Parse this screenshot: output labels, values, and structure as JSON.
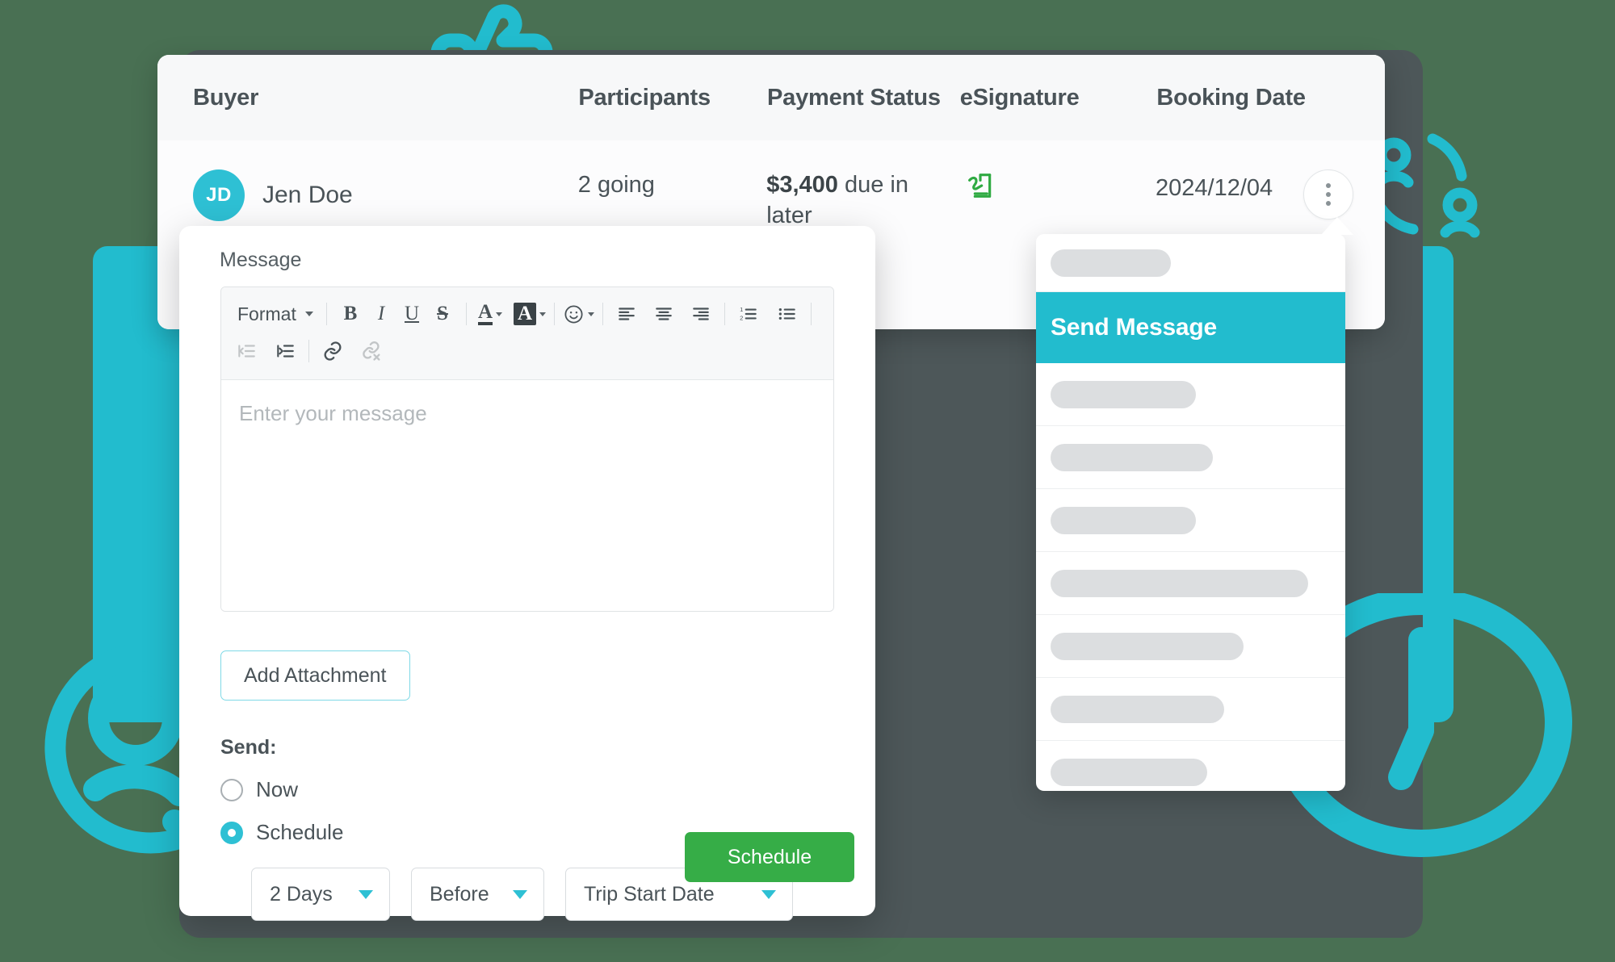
{
  "theme": {
    "page_background": "#497053",
    "card_dark": "#4D5759",
    "accent_cyan": "#22BCCE",
    "accent_cyan_light": "#2EC0D4",
    "success_green": "#36AD47",
    "esignature_green": "#2FAA42",
    "text_primary": "#4A5358",
    "placeholder_gray": "#B3B8BB",
    "skeleton_gray": "#DCDEE0"
  },
  "decorations": [
    {
      "name": "thumbs-up-icon",
      "color": "#22BCCE"
    },
    {
      "name": "smiley-face-icon",
      "color": "#22BCCE"
    },
    {
      "name": "clock-icon",
      "color": "#22BCCE"
    },
    {
      "name": "users-group-icon",
      "color": "#22BCCE"
    }
  ],
  "bookings_table": {
    "columns": [
      {
        "key": "buyer",
        "label": "Buyer"
      },
      {
        "key": "participants",
        "label": "Participants"
      },
      {
        "key": "payment_status",
        "label": "Payment Status"
      },
      {
        "key": "esignature",
        "label": "eSignature"
      },
      {
        "key": "booking_date",
        "label": "Booking Date"
      }
    ],
    "rows": [
      {
        "avatar_initials": "JD",
        "buyer_name": "Jen Doe",
        "participants": "2 going",
        "payment_amount": "$3,400",
        "payment_rest": " due in later",
        "esignature_icon": "signature-icon",
        "booking_date": "2024/12/04",
        "row_menu_icon": "kebab-menu-icon"
      }
    ]
  },
  "composer": {
    "label": "Message",
    "toolbar": {
      "format_label": "Format",
      "buttons": [
        {
          "name": "bold-icon",
          "glyph": "B"
        },
        {
          "name": "italic-icon",
          "glyph": "I"
        },
        {
          "name": "underline-icon",
          "glyph": "U"
        },
        {
          "name": "strikethrough-icon",
          "glyph": "S"
        },
        {
          "name": "text-color-icon",
          "glyph": "A"
        },
        {
          "name": "highlight-color-icon",
          "glyph": "A"
        },
        {
          "name": "emoji-icon",
          "glyph": "☺"
        },
        {
          "name": "align-left-icon",
          "glyph": ""
        },
        {
          "name": "align-center-icon",
          "glyph": ""
        },
        {
          "name": "align-right-icon",
          "glyph": ""
        },
        {
          "name": "ordered-list-icon",
          "glyph": ""
        },
        {
          "name": "unordered-list-icon",
          "glyph": ""
        },
        {
          "name": "outdent-icon",
          "glyph": ""
        },
        {
          "name": "indent-icon",
          "glyph": ""
        },
        {
          "name": "insert-link-icon",
          "glyph": ""
        },
        {
          "name": "remove-link-icon",
          "glyph": ""
        }
      ]
    },
    "message_placeholder": "Enter your message",
    "message_value": "",
    "add_attachment_label": "Add Attachment",
    "send_section_label": "Send:",
    "send_options": [
      {
        "label": "Now",
        "selected": false
      },
      {
        "label": "Schedule",
        "selected": true
      }
    ],
    "schedule_selects": [
      {
        "name": "schedule-offset-select",
        "value": "2 Days"
      },
      {
        "name": "schedule-relation-select",
        "value": "Before"
      },
      {
        "name": "schedule-anchor-select",
        "value": "Trip Start Date"
      }
    ],
    "submit_label": "Schedule"
  },
  "context_menu": {
    "active_item_label": "Send Message",
    "items": [
      {
        "type": "skeleton",
        "width_pct": 43
      },
      {
        "type": "active",
        "label": "Send Message"
      },
      {
        "type": "skeleton",
        "width_pct": 52
      },
      {
        "type": "skeleton",
        "width_pct": 58
      },
      {
        "type": "skeleton",
        "width_pct": 52
      },
      {
        "type": "skeleton",
        "width_pct": 92
      },
      {
        "type": "skeleton",
        "width_pct": 69
      },
      {
        "type": "skeleton",
        "width_pct": 62
      },
      {
        "type": "skeleton",
        "width_pct": 56
      }
    ]
  }
}
